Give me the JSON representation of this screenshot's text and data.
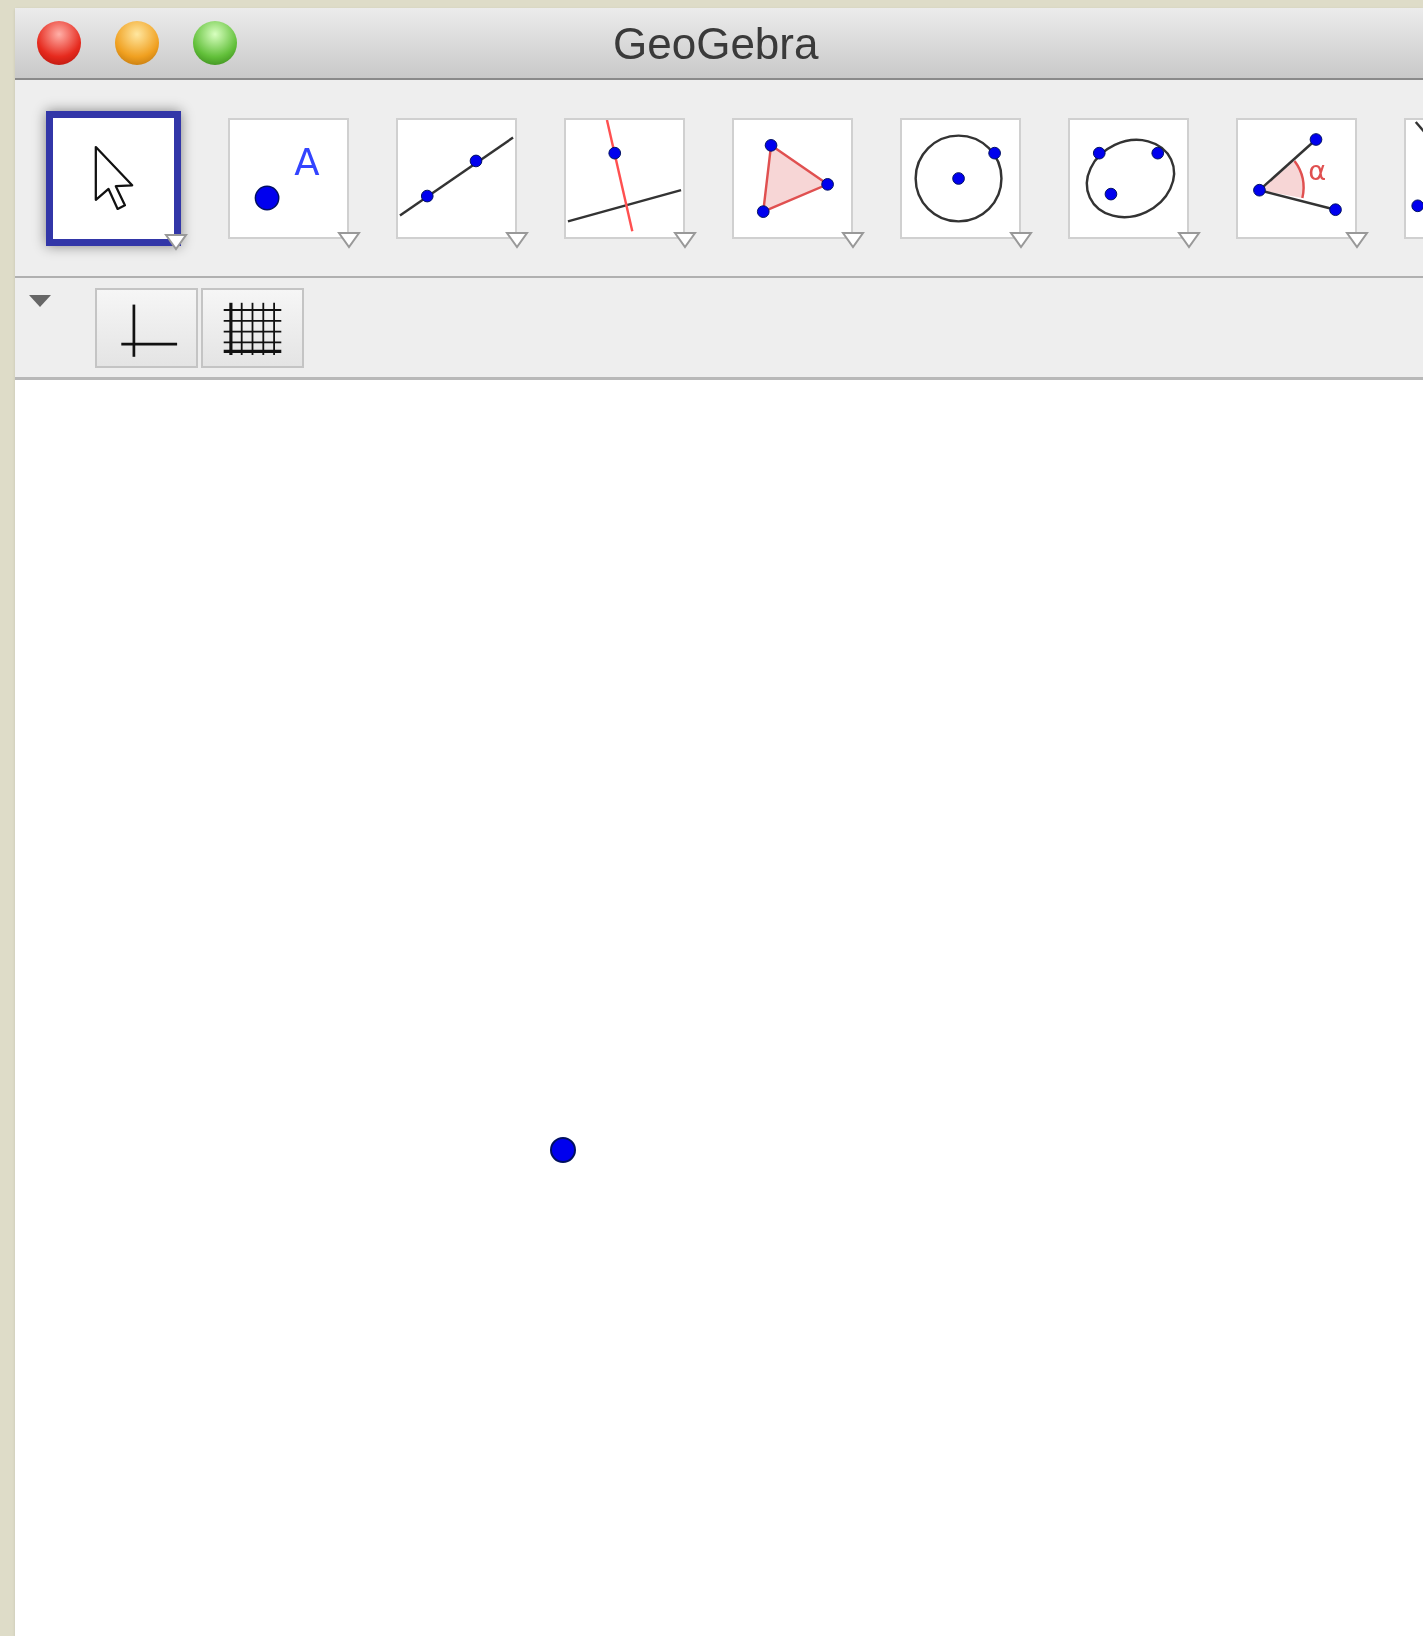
{
  "window": {
    "title": "GeoGebra"
  },
  "toolbar": {
    "tools": [
      {
        "kind": "move",
        "selected": true
      },
      {
        "kind": "point",
        "label": "A",
        "selected": false
      },
      {
        "kind": "line",
        "selected": false
      },
      {
        "kind": "perpendicular",
        "selected": false
      },
      {
        "kind": "polygon",
        "selected": false
      },
      {
        "kind": "circle",
        "selected": false
      },
      {
        "kind": "conic",
        "selected": false
      },
      {
        "kind": "angle",
        "label": "α",
        "selected": false
      },
      {
        "kind": "reflect",
        "selected": false
      }
    ]
  },
  "style_bar": {
    "buttons": [
      {
        "kind": "axes"
      },
      {
        "kind": "grid"
      }
    ]
  }
}
